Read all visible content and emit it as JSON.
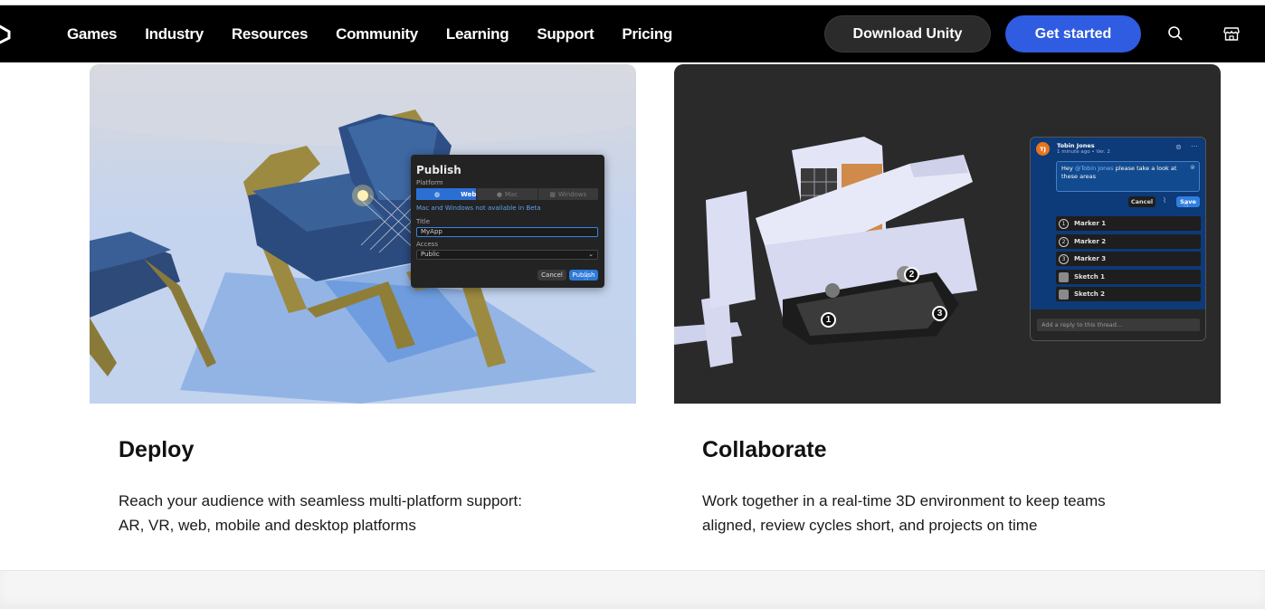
{
  "nav": {
    "links": [
      "Games",
      "Industry",
      "Resources",
      "Community",
      "Learning",
      "Support",
      "Pricing"
    ],
    "download_label": "Download Unity",
    "get_started_label": "Get started",
    "search_icon": "search-icon",
    "store_icon": "store-icon",
    "logo": "unity-logo-icon"
  },
  "cards": [
    {
      "title": "Deploy",
      "description_line1": "Reach your audience with seamless multi-platform support:",
      "description_line2": "AR, VR, web, mobile and desktop platforms",
      "dialog": {
        "heading": "Publish",
        "platform_label": "Platform",
        "platforms": [
          "Web",
          "Mac",
          "Windows"
        ],
        "note": "Mac and Windows not available in Beta",
        "title_label": "Title",
        "title_value": "MyApp",
        "access_label": "Access",
        "access_value": "Public",
        "cancel_label": "Cancel",
        "publish_label": "Publish"
      }
    },
    {
      "title": "Collaborate",
      "description_line1": "Work together in a real-time 3D environment to keep teams",
      "description_line2": "aligned, review cycles short, and projects on time",
      "panel": {
        "avatar_initials": "TJ",
        "author": "Tobin Jones",
        "meta": "1 minute ago • Ver. 2",
        "comment_prefix": "Hey",
        "mention": "@Tobin Jones",
        "comment_rest": "please take a look at these areas",
        "cancel_label": "Cancel",
        "save_label": "Save",
        "items": [
          {
            "marker": "1",
            "label": "Marker 1"
          },
          {
            "marker": "2",
            "label": "Marker 2"
          },
          {
            "marker": "3",
            "label": "Marker 3"
          },
          {
            "marker": "",
            "label": "Sketch 1"
          },
          {
            "marker": "",
            "label": "Sketch 2"
          }
        ],
        "reply_placeholder": "Add a reply to this thread...",
        "scene_markers": [
          "1",
          "2",
          "3"
        ]
      }
    }
  ],
  "colors": {
    "nav_bg": "#000000",
    "accent": "#2f5ce0",
    "panel_blue": "#0d3a78"
  }
}
